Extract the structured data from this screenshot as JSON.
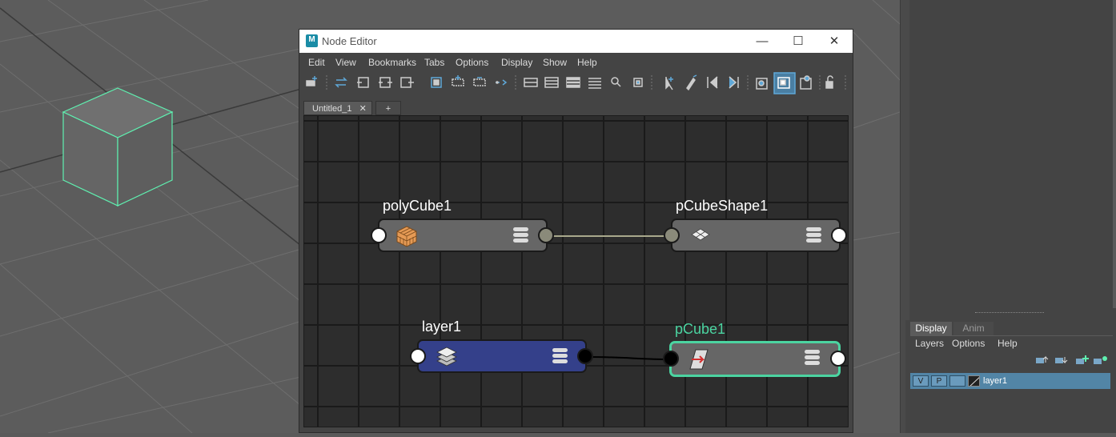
{
  "window": {
    "title": "Node Editor",
    "app_icon": "M",
    "controls": [
      "—",
      "☐",
      "✕"
    ]
  },
  "menu": [
    "Edit",
    "View",
    "Bookmarks",
    "Tabs",
    "Options",
    "Display",
    "Show",
    "Help"
  ],
  "toolbar_icons": [
    "add-node-icon",
    "swap-icon",
    "input-connections-icon",
    "io-connections-icon",
    "output-connections-icon",
    "frame-all-icon",
    "add-selected-icon",
    "remove-selected-icon",
    "graph-selected-icon",
    "simple-mode-icon",
    "connected-mode-icon",
    "full-mode-icon",
    "custom-mode-icon",
    "search-icon",
    "bookmark-icon",
    "select-icon",
    "pick-walk-icon",
    "previous-icon",
    "next-icon",
    "toggle-swatches-icon",
    "toggle-attributes-icon",
    "toggle-grid-icon",
    "lock-icon"
  ],
  "tabs": {
    "active": "Untitled_1",
    "close": "✕",
    "add": "+"
  },
  "nodes": {
    "polycube": {
      "title": "polyCube1"
    },
    "pcubeshape": {
      "title": "pCubeShape1"
    },
    "layer": {
      "title": "layer1"
    },
    "pcube": {
      "title": "pCube1"
    }
  },
  "layer_panel": {
    "tabs": [
      "Display",
      "Anim"
    ],
    "menu": [
      "Layers",
      "Options",
      "Help"
    ],
    "row": {
      "v": "V",
      "p": "P",
      "name": "layer1"
    }
  },
  "colors": {
    "selected_node": "#4bd4a1",
    "layer_node": "#34408a",
    "viewport_wire": "#5ff0b0"
  }
}
